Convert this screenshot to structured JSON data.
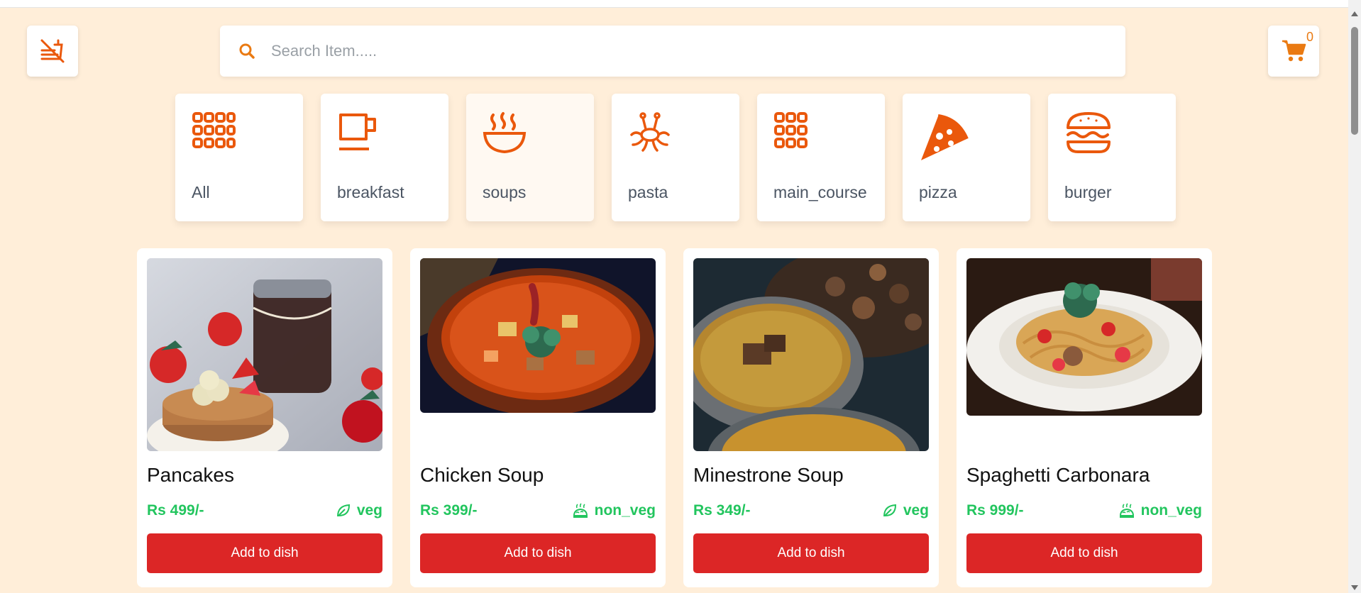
{
  "header": {
    "logo_icon": "no-fast-food-icon",
    "search_placeholder": "Search Item.....",
    "search_value": "",
    "cart_icon": "shopping-cart-icon",
    "cart_count": "0"
  },
  "colors": {
    "background": "#ffeed9",
    "accent_orange": "#ea580c",
    "button_red": "#dc2626",
    "price_green": "#22c55e"
  },
  "categories": [
    {
      "label": "All",
      "icon": "grid-icon"
    },
    {
      "label": "breakfast",
      "icon": "coffee-cup-icon"
    },
    {
      "label": "soups",
      "icon": "soup-bowl-icon",
      "selected": true
    },
    {
      "label": "pasta",
      "icon": "pasta-monster-icon"
    },
    {
      "label": "main_course",
      "icon": "grid-icon"
    },
    {
      "label": "pizza",
      "icon": "pizza-slice-icon"
    },
    {
      "label": "burger",
      "icon": "burger-icon"
    }
  ],
  "items": [
    {
      "name": "Pancakes",
      "price": "Rs 499/-",
      "type": "veg",
      "type_icon": "leaf-icon",
      "button": "Add to dish"
    },
    {
      "name": "Chicken Soup",
      "price": "Rs 399/-",
      "type": "non_veg",
      "type_icon": "drumstick-icon",
      "button": "Add to dish"
    },
    {
      "name": "Minestrone Soup",
      "price": "Rs 349/-",
      "type": "veg",
      "type_icon": "leaf-icon",
      "button": "Add to dish"
    },
    {
      "name": "Spaghetti Carbonara",
      "price": "Rs 999/-",
      "type": "non_veg",
      "type_icon": "drumstick-icon",
      "button": "Add to dish"
    }
  ]
}
